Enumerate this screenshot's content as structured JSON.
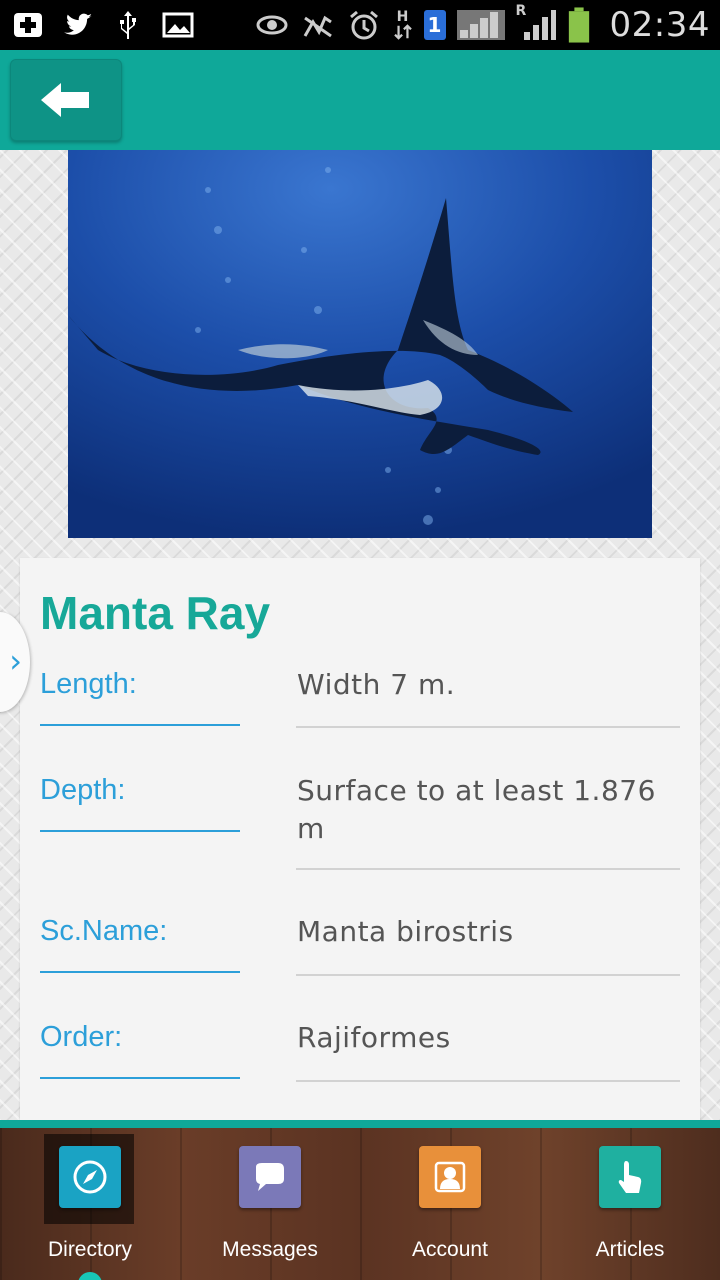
{
  "status_bar": {
    "time": "02:34",
    "sim_number": "1",
    "network_h": "H",
    "network_r": "R",
    "icons_left": [
      "plus-box-icon",
      "twitter-icon",
      "usb-icon",
      "image-icon"
    ],
    "icons_right": [
      "eye-icon",
      "no-signal-icon",
      "alarm-icon",
      "data-arrows-icon",
      "sim-icon",
      "signal-icon",
      "roaming-signal-icon",
      "battery-icon"
    ],
    "battery_level": 0.8
  },
  "header": {
    "back_icon": "arrow-left-icon",
    "accent_color": "#0fa899"
  },
  "species": {
    "name": "Manta Ray",
    "photo": "manta-ray-underwater-photo",
    "fields": [
      {
        "label": "Length:",
        "value": "Width 7 m."
      },
      {
        "label": "Depth:",
        "value": "Surface to at least 1.876 m"
      },
      {
        "label": "Sc.Name:",
        "value": "Manta birostris"
      },
      {
        "label": "Order:",
        "value": "Rajiformes"
      }
    ]
  },
  "drawer": {
    "handle_glyph": "›"
  },
  "bottom_nav": {
    "items": [
      {
        "label": "Directory",
        "icon": "compass-icon",
        "color": "#1aa3c4",
        "active": true
      },
      {
        "label": "Messages",
        "icon": "chat-bubble-icon",
        "color": "#7b79b8",
        "active": false
      },
      {
        "label": "Account",
        "icon": "person-icon",
        "color": "#e8903a",
        "active": false
      },
      {
        "label": "Articles",
        "icon": "touch-hand-icon",
        "color": "#1fb0a0",
        "active": false
      }
    ]
  }
}
